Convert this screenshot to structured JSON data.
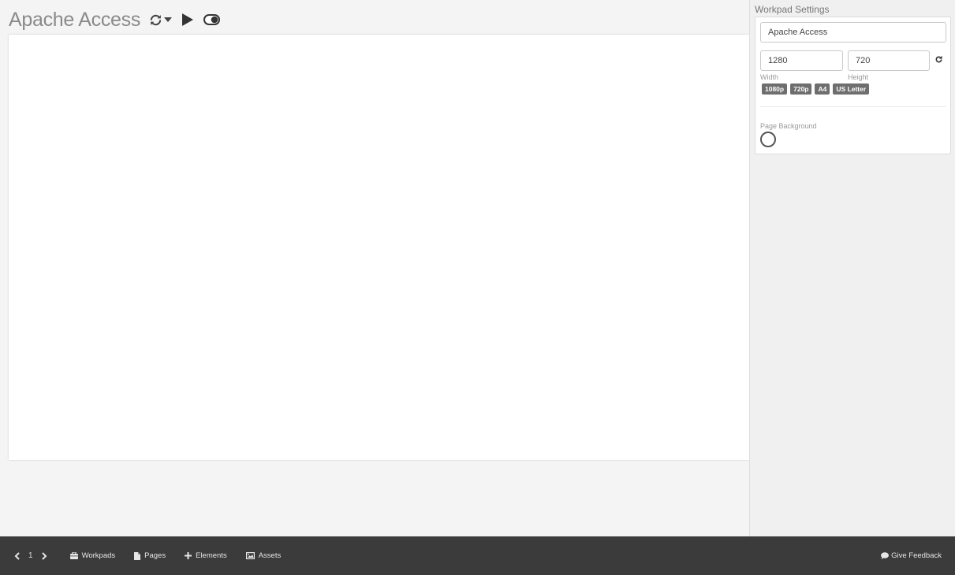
{
  "workspace": {
    "title": "Apache Access",
    "tools": {
      "refresh_icon": "refresh-icon",
      "play_icon": "play-icon",
      "toggle_icon": "toggle-icon"
    }
  },
  "sidebar": {
    "panel_title": "Workpad Settings",
    "name_value": "Apache Access",
    "width_value": "1280",
    "height_value": "720",
    "width_label": "Width",
    "height_label": "Height",
    "presets": [
      "1080p",
      "720p",
      "A4",
      "US Letter"
    ],
    "page_background_label": "Page Background"
  },
  "footer": {
    "page_number": "1",
    "nav": {
      "workpads": "Workpads",
      "pages": "Pages",
      "elements": "Elements",
      "assets": "Assets"
    },
    "feedback": "Give Feedback"
  },
  "colors": {
    "footer_bg": "#3b3b3b",
    "preset_bg": "#6e6e6e",
    "canvas_bg": "#ffffff",
    "workspace_bg": "#f4f4f4"
  }
}
